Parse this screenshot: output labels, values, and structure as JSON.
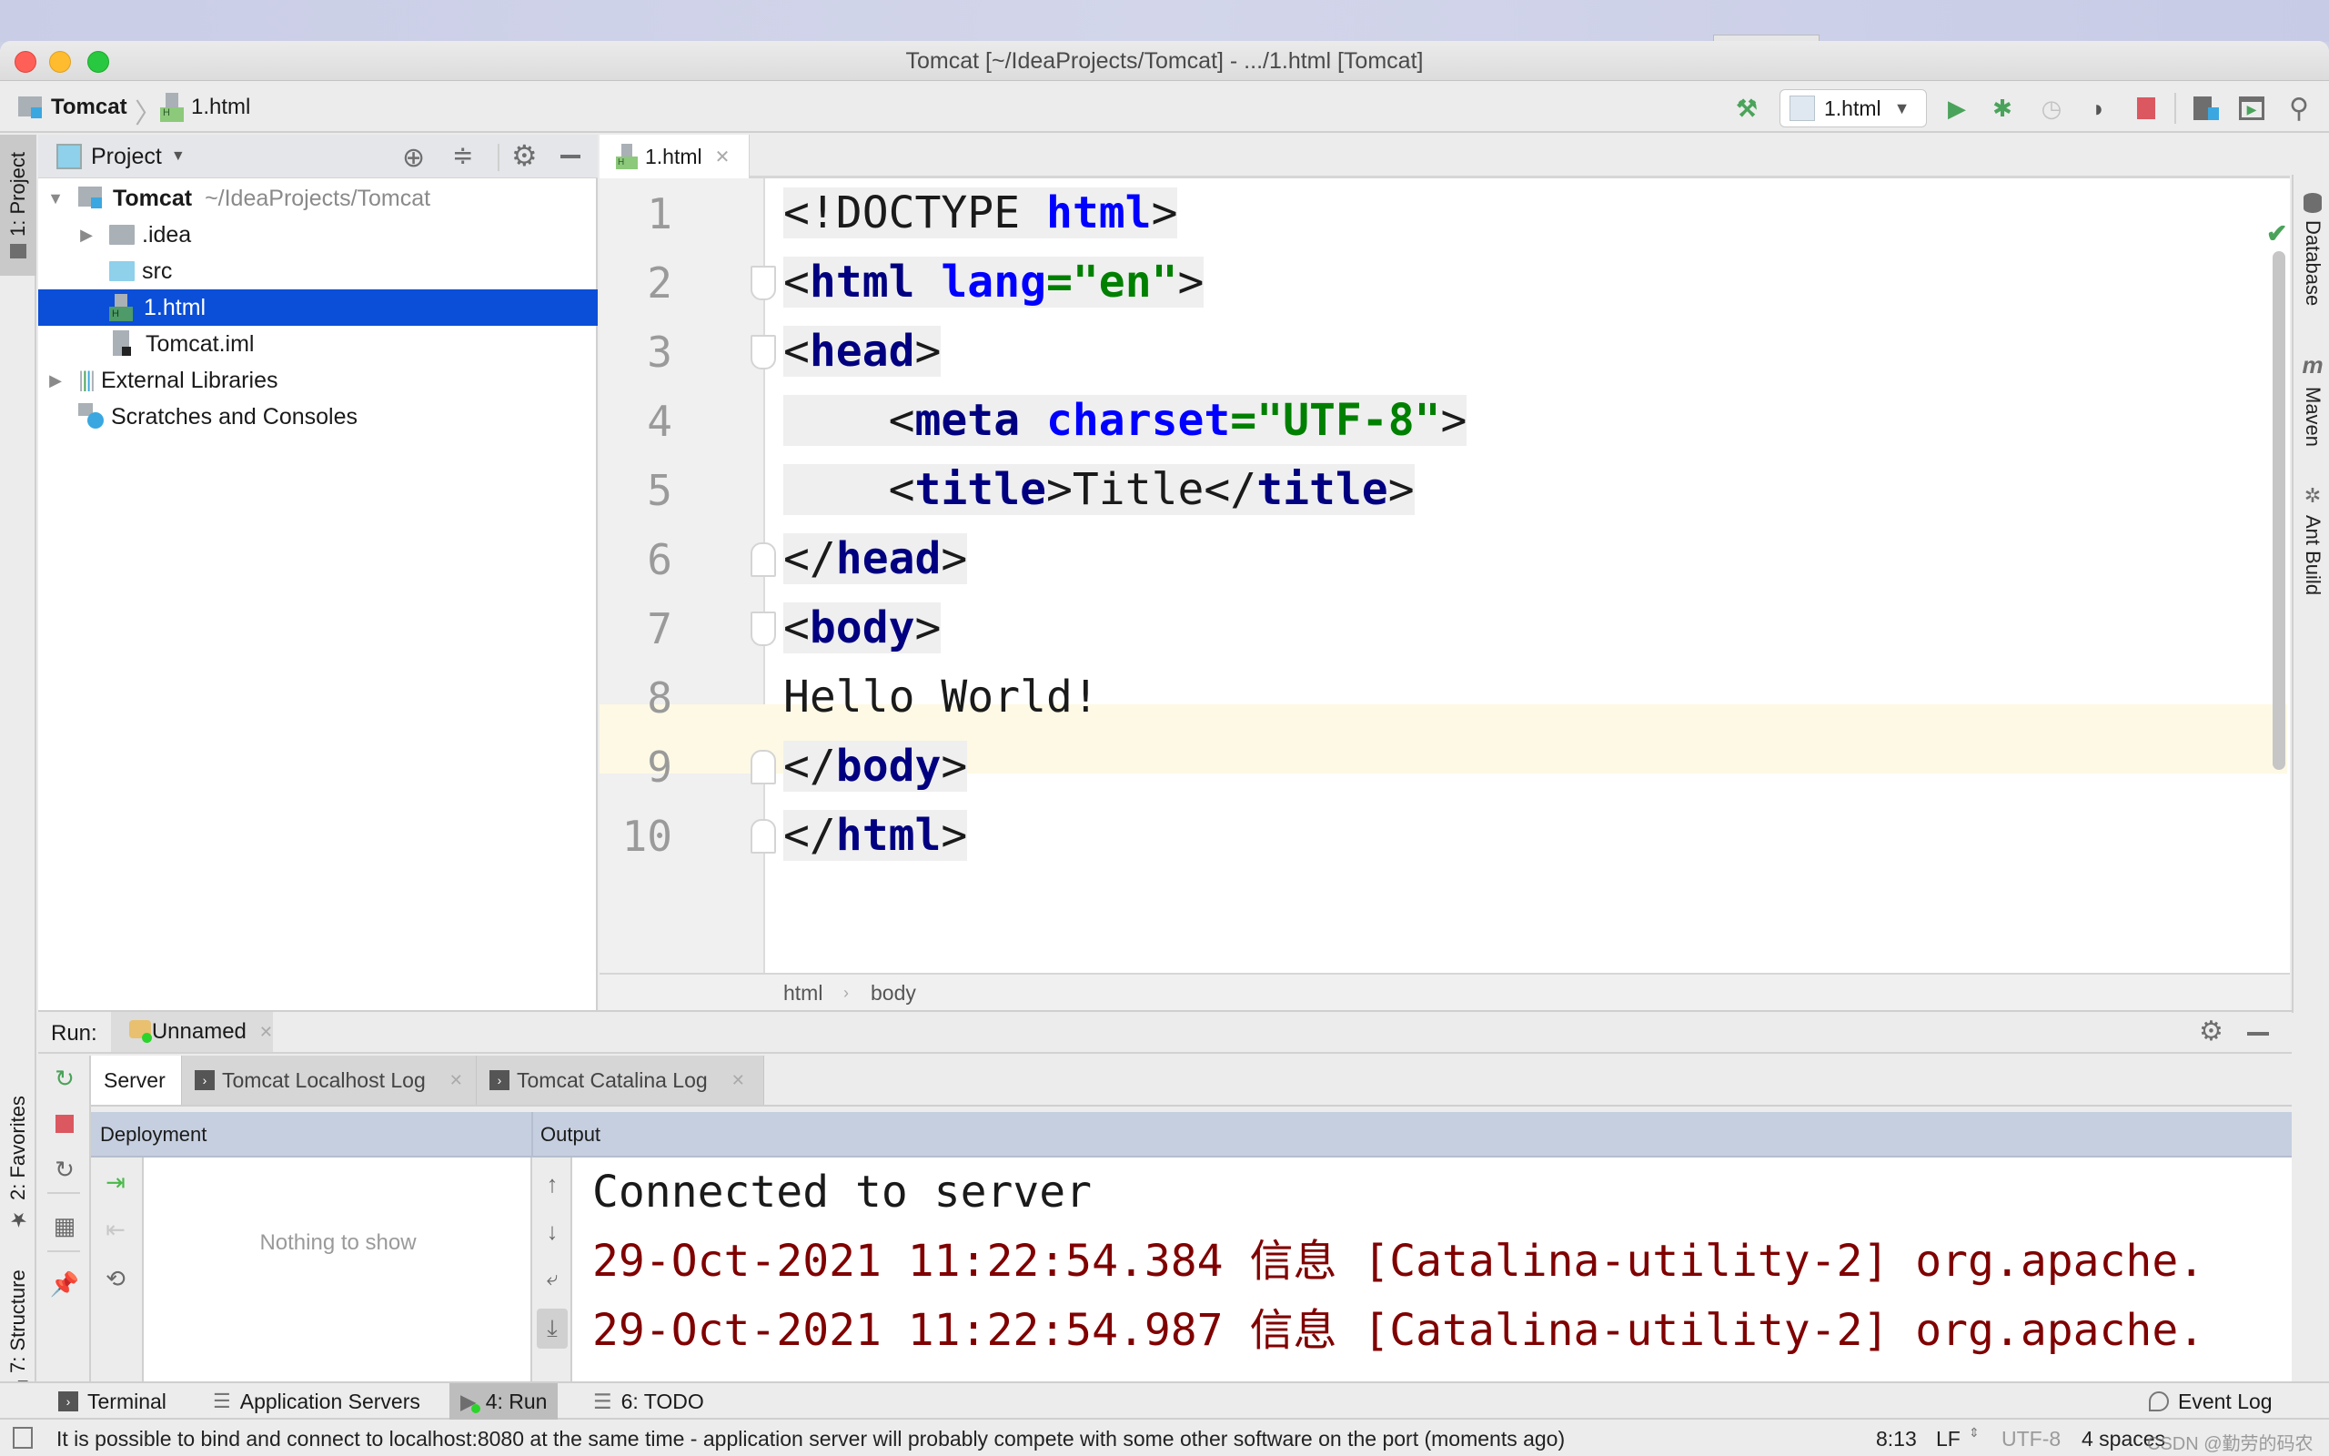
{
  "window": {
    "title": "Tomcat [~/IdeaProjects/Tomcat] - .../1.html [Tomcat]",
    "traffic_lights": {
      "close": "#fe5f57",
      "minimize": "#febc2e",
      "maximize": "#28c840"
    }
  },
  "navbar": {
    "project": "Tomcat",
    "file": "1.html",
    "run_config": "1.html",
    "icons": [
      "build-hammer-icon",
      "run-icon",
      "debug-icon",
      "profile-icon",
      "coverage-icon",
      "stop-icon",
      "project-structure-icon",
      "run-anything-icon",
      "search-icon"
    ]
  },
  "left_stripe": {
    "project_tab": "1: Project",
    "favorites_tab": "2: Favorites",
    "structure_tab": "7: Structure"
  },
  "project_panel": {
    "title": "Project",
    "tree": [
      {
        "label": "Tomcat",
        "path": "~/IdeaProjects/Tomcat",
        "type": "module",
        "expanded": true,
        "depth": 0
      },
      {
        "label": ".idea",
        "type": "folder",
        "expanded": false,
        "depth": 1
      },
      {
        "label": "src",
        "type": "source-folder",
        "depth": 1
      },
      {
        "label": "1.html",
        "type": "html-file",
        "depth": 1,
        "selected": true
      },
      {
        "label": "Tomcat.iml",
        "type": "iml-file",
        "depth": 1
      },
      {
        "label": "External Libraries",
        "type": "libraries",
        "expanded": false,
        "depth": 0
      },
      {
        "label": "Scratches and Consoles",
        "type": "scratches",
        "depth": 0
      }
    ]
  },
  "editor": {
    "tab": "1.html",
    "lines": [
      {
        "n": "1",
        "tokens": [
          [
            "p",
            "<!DOCTYPE "
          ],
          [
            "kw",
            "html"
          ],
          [
            "p",
            ">"
          ]
        ]
      },
      {
        "n": "2",
        "tokens": [
          [
            "p",
            "<"
          ],
          [
            "tag",
            "html"
          ],
          [
            "p",
            " "
          ],
          [
            "attr",
            "lang"
          ],
          [
            "val",
            "=\"en\""
          ],
          [
            "p",
            ">"
          ]
        ]
      },
      {
        "n": "3",
        "tokens": [
          [
            "p",
            "<"
          ],
          [
            "tag",
            "head"
          ],
          [
            "p",
            ">"
          ]
        ]
      },
      {
        "n": "4",
        "tokens": [
          [
            "p",
            "    <"
          ],
          [
            "tag",
            "meta"
          ],
          [
            "p",
            " "
          ],
          [
            "attr",
            "charset"
          ],
          [
            "val",
            "=\"UTF-8\""
          ],
          [
            "p",
            ">"
          ]
        ]
      },
      {
        "n": "5",
        "tokens": [
          [
            "p",
            "    <"
          ],
          [
            "tag",
            "title"
          ],
          [
            "p",
            ">Title</"
          ],
          [
            "tag",
            "title"
          ],
          [
            "p",
            ">"
          ]
        ]
      },
      {
        "n": "6",
        "tokens": [
          [
            "p",
            "</"
          ],
          [
            "tag",
            "head"
          ],
          [
            "p",
            ">"
          ]
        ]
      },
      {
        "n": "7",
        "tokens": [
          [
            "p",
            "<"
          ],
          [
            "tag",
            "body"
          ],
          [
            "p",
            ">"
          ]
        ]
      },
      {
        "n": "8",
        "tokens": [
          [
            "p",
            "Hello World!"
          ]
        ]
      },
      {
        "n": "9",
        "tokens": [
          [
            "p",
            "</"
          ],
          [
            "tag",
            "body"
          ],
          [
            "p",
            ">"
          ]
        ]
      },
      {
        "n": "10",
        "tokens": [
          [
            "p",
            "</"
          ],
          [
            "tag",
            "html"
          ],
          [
            "p",
            ">"
          ]
        ]
      }
    ],
    "current_line": 8,
    "breadcrumb": [
      "html",
      "body"
    ]
  },
  "right_stripe": [
    "Database",
    "Maven",
    "Ant Build"
  ],
  "run_panel": {
    "label": "Run:",
    "config_tab": "Unnamed",
    "tabs": [
      "Server",
      "Tomcat Localhost Log",
      "Tomcat Catalina Log"
    ],
    "active_tab": "Server",
    "deployment_header": "Deployment",
    "output_header": "Output",
    "deployment_empty": "Nothing to show",
    "output": [
      {
        "text": "Connected to server",
        "level": "normal"
      },
      {
        "text": "29-Oct-2021 11:22:54.384 信息 [Catalina-utility-2] org.apache.",
        "level": "info"
      },
      {
        "text": "29-Oct-2021 11:22:54.987 信息 [Catalina-utility-2] org.apache.",
        "level": "info"
      }
    ]
  },
  "tool_stripe": {
    "items": [
      {
        "label": "Terminal",
        "icon": "terminal-icon"
      },
      {
        "label": "Application Servers",
        "icon": "app-servers-icon"
      },
      {
        "label": "4: Run",
        "icon": "run-icon",
        "active": true
      },
      {
        "label": "6: TODO",
        "icon": "todo-list-icon"
      }
    ],
    "event_log": "Event Log"
  },
  "status_bar": {
    "message": "It is possible to bind and connect to localhost:8080 at the same time - application server will probably compete with some other software on the port (moments ago)",
    "position": "8:13",
    "line_sep": "LF",
    "encoding": "UTF-8",
    "indent": "4 spaces",
    "watermark": "CSDN @勤劳的码农"
  }
}
